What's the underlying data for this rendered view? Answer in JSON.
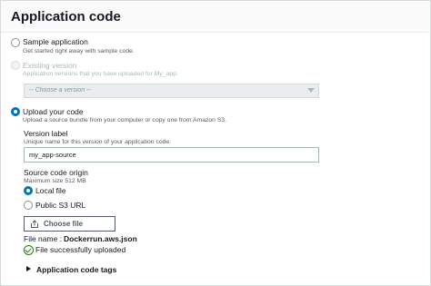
{
  "panel": {
    "title": "Application code"
  },
  "options": {
    "sample": {
      "label": "Sample application",
      "description": "Get started right away with sample code."
    },
    "existing": {
      "label": "Existing version",
      "description": "Application versions that you have uploaded for My_app.",
      "select_placeholder": "-- Choose a version --"
    },
    "upload": {
      "label": "Upload your code",
      "description": "Upload a source bundle from your computer or copy one from Amazon S3."
    }
  },
  "version_label": {
    "label": "Version label",
    "description": "Unique name for this version of your application code.",
    "value": "my_app-source"
  },
  "source_origin": {
    "label": "Source code origin",
    "description": "Maximum size 512 MB",
    "local_file": "Local file",
    "s3_url": "Public S3 URL"
  },
  "choose_file": {
    "label": "Choose file"
  },
  "file": {
    "name_prefix": "File name :",
    "name": "Dockerrun.aws.json",
    "status": "File successfully uploaded"
  },
  "tags": {
    "label": "Application code tags"
  },
  "colors": {
    "accent": "#0073bb",
    "success": "#1d8102",
    "text": "#16191f"
  },
  "icons": [
    "upload-icon",
    "success-check-icon",
    "caret-right-icon",
    "chevron-down-icon"
  ]
}
